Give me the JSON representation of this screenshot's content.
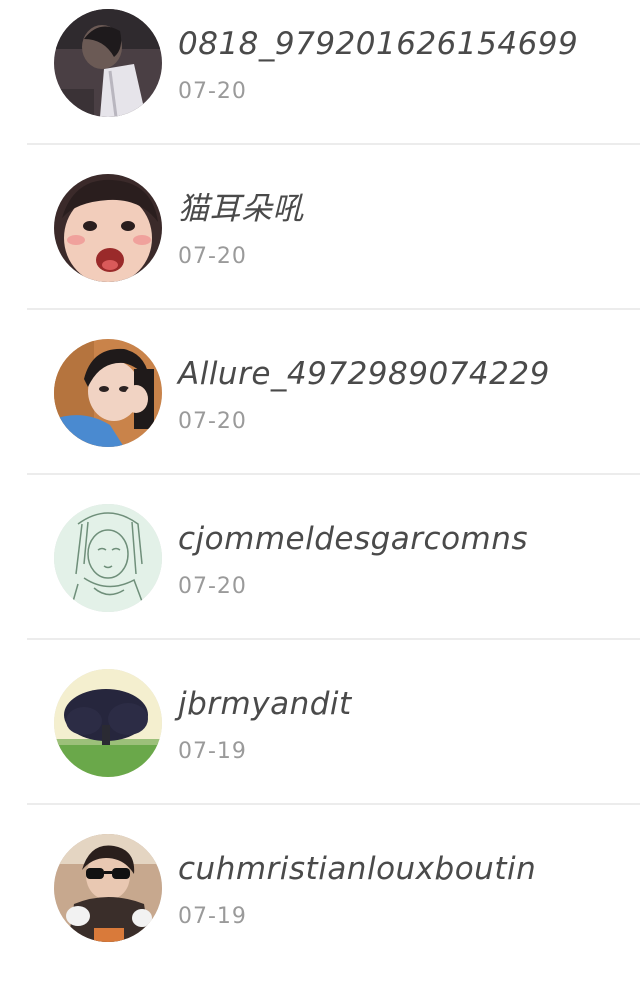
{
  "contacts": [
    {
      "name": "0818_979201626154699",
      "date": "07-20",
      "avatar": "avatar-dark-figure"
    },
    {
      "name": "猫耳朵吼",
      "date": "07-20",
      "avatar": "avatar-surprised-face"
    },
    {
      "name": "Allure_4972989074229",
      "date": "07-20",
      "avatar": "avatar-girl-selfie"
    },
    {
      "name": "cjommeldesgarcomns",
      "date": "07-20",
      "avatar": "avatar-line-drawing"
    },
    {
      "name": "jbrmyandit",
      "date": "07-19",
      "avatar": "avatar-tree"
    },
    {
      "name": "cuhmristianlouxboutin",
      "date": "07-19",
      "avatar": "avatar-sunglasses"
    }
  ]
}
